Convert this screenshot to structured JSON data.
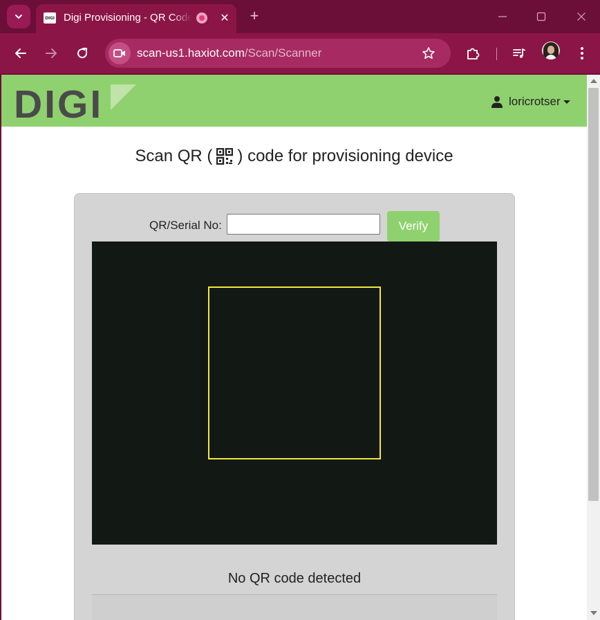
{
  "browser": {
    "tab_title": "Digi Provisioning - QR Code Scanner",
    "favicon_text": "DIGI",
    "url_host": "scan-us1.haxiot.com",
    "url_path": "/Scan/Scanner",
    "new_tab_glyph": "+",
    "close_glyph": "✕",
    "accent_color": "#8c1547",
    "icons": [
      "tab-search-icon",
      "tab-record-icon",
      "close-icon",
      "new-tab-icon",
      "minimize-icon",
      "maximize-icon",
      "window-close-icon",
      "back-icon",
      "forward-icon",
      "reload-icon",
      "site-info-icon",
      "bookmark-star-icon",
      "extensions-icon",
      "media-control-icon",
      "profile-avatar",
      "menu-kebab-icon"
    ]
  },
  "header": {
    "logo_text": "DIGI",
    "username": "loricrotser",
    "brand_color": "#8fd16f"
  },
  "page": {
    "heading_before": "Scan QR (",
    "heading_after": ") code for provisioning device",
    "serial_label": "QR/Serial No:",
    "serial_value": "",
    "verify_label": "Verify",
    "status_text": "No QR code detected"
  }
}
